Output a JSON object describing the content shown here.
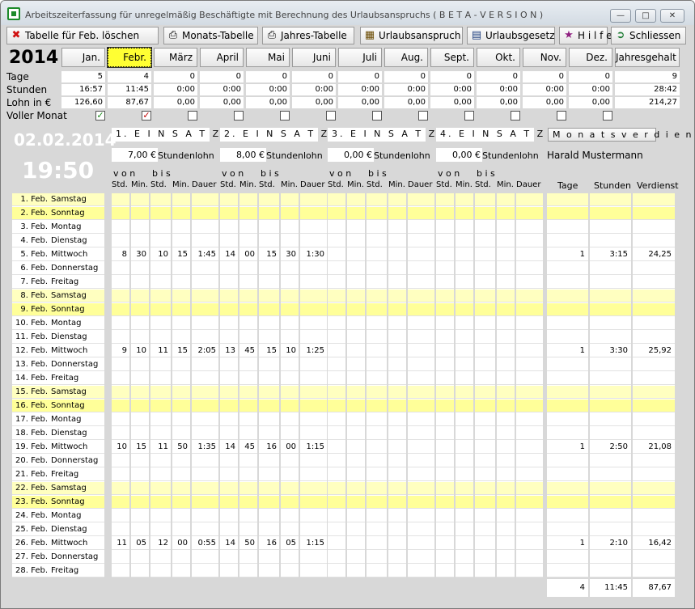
{
  "window": {
    "title": "Arbeitszeiterfassung für unregelmäßig Beschäftigte mit Berechnung des Urlaubsanspruchs  ( B E T A  - V E R S I O N )"
  },
  "toolbar": {
    "clear": "Tabelle für Feb. löschen",
    "month_table": "Monats-Tabelle",
    "year_table": "Jahres-Tabelle",
    "vacation": "Urlaubsanspruch",
    "law": "Urlaubsgesetz",
    "help": "H i l f e",
    "close": "Schliessen"
  },
  "year": "2014",
  "months": [
    "Jan.",
    "Febr.",
    "März",
    "April",
    "Mai",
    "Juni",
    "Juli",
    "Aug.",
    "Sept.",
    "Okt.",
    "Nov.",
    "Dez."
  ],
  "annual_label": "Jahresgehalt",
  "selected_month": 1,
  "summary": {
    "labels": {
      "tage": "Tage",
      "stunden": "Stunden",
      "lohn": "Lohn in €",
      "voller": "Voller Monat"
    },
    "tage": [
      "5",
      "4",
      "0",
      "0",
      "0",
      "0",
      "0",
      "0",
      "0",
      "0",
      "0",
      "0",
      "9"
    ],
    "stunden": [
      "16:57",
      "11:45",
      "0:00",
      "0:00",
      "0:00",
      "0:00",
      "0:00",
      "0:00",
      "0:00",
      "0:00",
      "0:00",
      "0:00",
      "28:42"
    ],
    "lohn": [
      "126,60",
      "87,67",
      "0,00",
      "0,00",
      "0,00",
      "0,00",
      "0,00",
      "0,00",
      "0,00",
      "0,00",
      "0,00",
      "0,00",
      "214,27"
    ],
    "voller": [
      true,
      true,
      false,
      false,
      false,
      false,
      false,
      false,
      false,
      false,
      false,
      false
    ]
  },
  "current_date": "02.02.2014",
  "current_time": "19:50",
  "einsatz": [
    {
      "title": "1. E I N S A T Z",
      "rate": "7,00 €"
    },
    {
      "title": "2. E I N S A T Z",
      "rate": "8,00 €"
    },
    {
      "title": "3. E I N S A T Z",
      "rate": "0,00 €"
    },
    {
      "title": "4. E I N S A T Z",
      "rate": "0,00 €"
    }
  ],
  "rate_label": "Stundenlohn",
  "col_labels": {
    "von": "v o n",
    "bis": "b i s",
    "std": "Std.",
    "min": "Min.",
    "dauer": "Dauer"
  },
  "monthly": {
    "title": "M o n a t s v e r d i e n s t",
    "name": "Harald Mustermann",
    "tage": "Tage",
    "stunden": "Stunden",
    "verdienst": "Verdienst"
  },
  "days": [
    {
      "d": "1. Feb.",
      "n": "Samstag",
      "we": true
    },
    {
      "d": "2. Feb.",
      "n": "Sonntag",
      "we": true,
      "today": true
    },
    {
      "d": "3. Feb.",
      "n": "Montag"
    },
    {
      "d": "4. Feb.",
      "n": "Dienstag"
    },
    {
      "d": "5. Feb.",
      "n": "Mittwoch",
      "e1": [
        "8",
        "30",
        "10",
        "15",
        "1:45"
      ],
      "e2": [
        "14",
        "00",
        "15",
        "30",
        "1:30"
      ],
      "sum": [
        "1",
        "3:15",
        "24,25"
      ]
    },
    {
      "d": "6. Feb.",
      "n": "Donnerstag"
    },
    {
      "d": "7. Feb.",
      "n": "Freitag"
    },
    {
      "d": "8. Feb.",
      "n": "Samstag",
      "we": true
    },
    {
      "d": "9. Feb.",
      "n": "Sonntag",
      "we": true,
      "today": true
    },
    {
      "d": "10. Feb.",
      "n": "Montag"
    },
    {
      "d": "11. Feb.",
      "n": "Dienstag"
    },
    {
      "d": "12. Feb.",
      "n": "Mittwoch",
      "e1": [
        "9",
        "10",
        "11",
        "15",
        "2:05"
      ],
      "e2": [
        "13",
        "45",
        "15",
        "10",
        "1:25"
      ],
      "sum": [
        "1",
        "3:30",
        "25,92"
      ]
    },
    {
      "d": "13. Feb.",
      "n": "Donnerstag"
    },
    {
      "d": "14. Feb.",
      "n": "Freitag"
    },
    {
      "d": "15. Feb.",
      "n": "Samstag",
      "we": true
    },
    {
      "d": "16. Feb.",
      "n": "Sonntag",
      "we": true,
      "today": true
    },
    {
      "d": "17. Feb.",
      "n": "Montag"
    },
    {
      "d": "18. Feb.",
      "n": "Dienstag"
    },
    {
      "d": "19. Feb.",
      "n": "Mittwoch",
      "e1": [
        "10",
        "15",
        "11",
        "50",
        "1:35"
      ],
      "e2": [
        "14",
        "45",
        "16",
        "00",
        "1:15"
      ],
      "sum": [
        "1",
        "2:50",
        "21,08"
      ]
    },
    {
      "d": "20. Feb.",
      "n": "Donnerstag"
    },
    {
      "d": "21. Feb.",
      "n": "Freitag"
    },
    {
      "d": "22. Feb.",
      "n": "Samstag",
      "we": true
    },
    {
      "d": "23. Feb.",
      "n": "Sonntag",
      "we": true,
      "today": true
    },
    {
      "d": "24. Feb.",
      "n": "Montag"
    },
    {
      "d": "25. Feb.",
      "n": "Dienstag"
    },
    {
      "d": "26. Feb.",
      "n": "Mittwoch",
      "e1": [
        "11",
        "05",
        "12",
        "00",
        "0:55"
      ],
      "e2": [
        "14",
        "50",
        "16",
        "05",
        "1:15"
      ],
      "sum": [
        "1",
        "2:10",
        "16,42"
      ]
    },
    {
      "d": "27. Feb.",
      "n": "Donnerstag"
    },
    {
      "d": "28. Feb.",
      "n": "Freitag"
    }
  ],
  "totals": [
    "4",
    "11:45",
    "87,67"
  ],
  "colors": {
    "weekend": "#ffffc0",
    "sunday": "#ffff99",
    "selected_month": "#ffff33"
  }
}
